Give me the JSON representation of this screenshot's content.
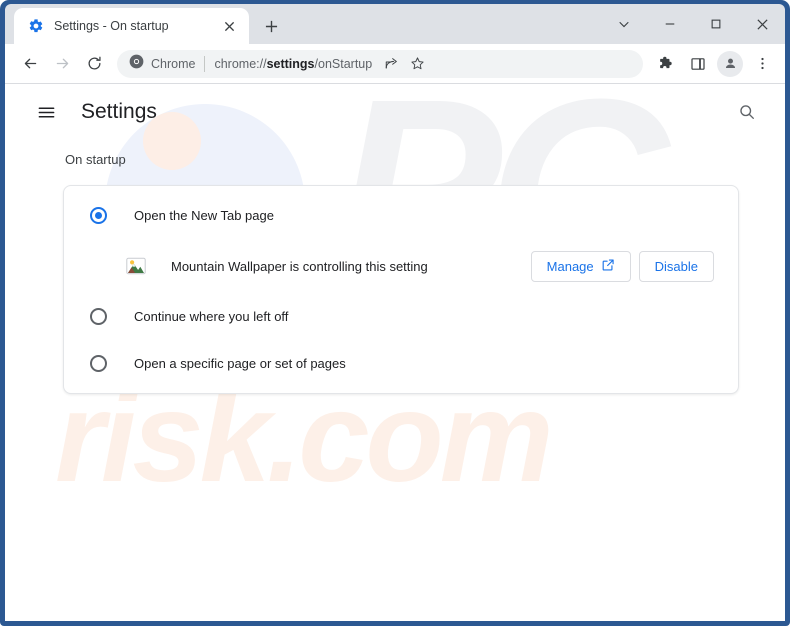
{
  "window": {
    "frame_color": "#2c5892",
    "controls": [
      {
        "name": "tab-search-chevron",
        "icon": "chevron-down-icon"
      },
      {
        "name": "minimize",
        "icon": "minimize-icon"
      },
      {
        "name": "maximize",
        "icon": "maximize-icon"
      },
      {
        "name": "close",
        "icon": "close-icon"
      }
    ]
  },
  "tab": {
    "title": "Settings - On startup",
    "favicon": "settings-gear-icon",
    "close_icon": "close-icon",
    "new_tab_icon": "plus-icon"
  },
  "toolbar": {
    "back_icon": "back-arrow-icon",
    "forward_icon": "forward-arrow-icon",
    "reload_icon": "reload-icon",
    "omnibox": {
      "chip_icon": "chrome-logo-icon",
      "chip_label": "Chrome",
      "url_prefix": "chrome://",
      "url_bold": "settings",
      "url_suffix": "/onStartup",
      "share_icon": "share-icon",
      "bookmark_icon": "star-icon"
    },
    "extensions_icon": "puzzle-piece-icon",
    "side_panel_icon": "side-panel-icon",
    "profile_icon": "person-avatar-icon",
    "menu_icon": "three-dot-menu-icon"
  },
  "settings": {
    "menu_icon": "hamburger-menu-icon",
    "title": "Settings",
    "search_icon": "search-icon",
    "section_label": "On startup",
    "options": [
      {
        "label": "Open the New Tab page",
        "selected": true
      },
      {
        "label": "Continue where you left off",
        "selected": false
      },
      {
        "label": "Open a specific page or set of pages",
        "selected": false
      }
    ],
    "extension_notice": {
      "icon": "mountain-wallpaper-icon",
      "text": "Mountain Wallpaper is controlling this setting",
      "manage_label": "Manage",
      "manage_icon": "external-link-icon",
      "disable_label": "Disable"
    }
  },
  "watermarks": {
    "primary": "PC",
    "secondary": "risk.com",
    "primary_color": "#f1f2f4",
    "secondary_color": "#fdf0e8"
  }
}
